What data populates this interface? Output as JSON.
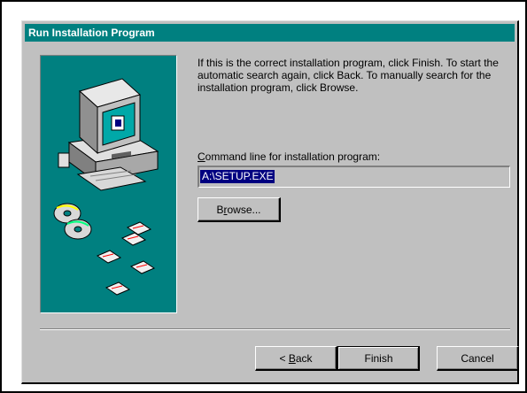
{
  "dialog": {
    "title": "Run Installation Program",
    "description": "If this is the correct installation program, click Finish. To start the automatic search again, click Back. To manually search for the installation program, click Browse.",
    "command_line": {
      "label_access_key": "C",
      "label_rest": "ommand line for installation program:",
      "value": "A:\\SETUP.EXE"
    },
    "buttons": {
      "browse_access": "r",
      "browse_pre": "B",
      "browse_post": "owse...",
      "back_prefix": "< ",
      "back_access": "B",
      "back_rest": "ack",
      "finish": "Finish",
      "cancel": "Cancel"
    }
  },
  "illustration": {
    "icons": [
      "computer-icon",
      "compact-disc-icon",
      "floppy-disk-icon"
    ],
    "colors": {
      "background": "#008080",
      "monitor": "#c0c0c0",
      "screen": "#00a8a8"
    }
  },
  "colors": {
    "titlebar": "#008080",
    "window": "#c0c0c0",
    "selection": "#000080"
  }
}
